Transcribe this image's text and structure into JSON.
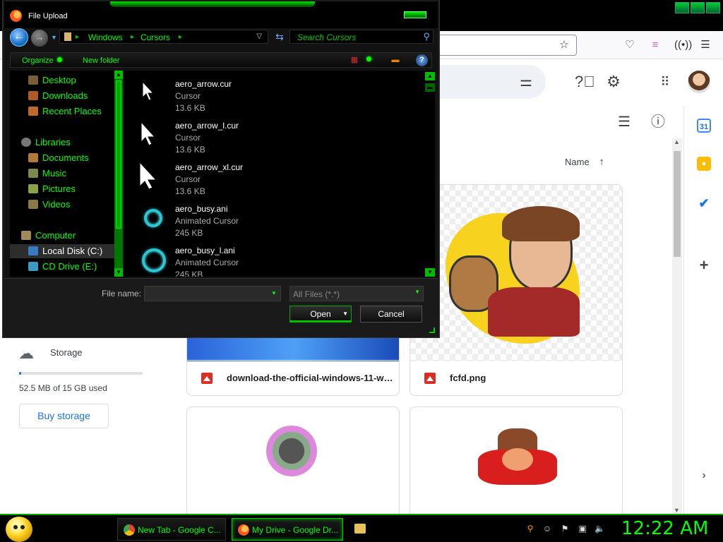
{
  "dialog": {
    "title": "File Upload",
    "breadcrumb": [
      "Windows",
      "Cursors"
    ],
    "search_placeholder": "Search Cursors",
    "toolbar": {
      "organize": "Organize",
      "new_folder": "New folder"
    },
    "nav_items": [
      {
        "label": "Desktop",
        "color": "#7a5c3a"
      },
      {
        "label": "Downloads",
        "color": "#b05a2a"
      },
      {
        "label": "Recent Places",
        "color": "#c06a2a"
      },
      {
        "label": "Libraries",
        "color": "#777777"
      },
      {
        "label": "Documents",
        "color": "#b07a3a"
      },
      {
        "label": "Music",
        "color": "#7a8a4a"
      },
      {
        "label": "Pictures",
        "color": "#8aa04a"
      },
      {
        "label": "Videos",
        "color": "#8a7a4a"
      },
      {
        "label": "Computer",
        "color": "#a08a5a"
      },
      {
        "label": "Local Disk (C:)",
        "color": "#3a7ac0",
        "selected": true
      },
      {
        "label": "CD Drive (E:)",
        "color": "#3a9ac0"
      }
    ],
    "files": [
      {
        "name": "aero_arrow.cur",
        "type": "Cursor",
        "size": "13.6 KB",
        "icon": "arrow-cursor-icon"
      },
      {
        "name": "aero_arrow_l.cur",
        "type": "Cursor",
        "size": "13.6 KB",
        "icon": "arrow-cursor-icon"
      },
      {
        "name": "aero_arrow_xl.cur",
        "type": "Cursor",
        "size": "13.6 KB",
        "icon": "arrow-cursor-icon"
      },
      {
        "name": "aero_busy.ani",
        "type": "Animated Cursor",
        "size": "245 KB",
        "icon": "busy-ring-icon"
      },
      {
        "name": "aero_busy_l.ani",
        "type": "Animated Cursor",
        "size": "245 KB",
        "icon": "busy-ring-icon"
      }
    ],
    "file_name_label": "File name:",
    "file_name_value": "",
    "filter_value": "All Files (*.*)",
    "open_label": "Open",
    "cancel_label": "Cancel"
  },
  "drive": {
    "sort_label": "Name",
    "storage_label": "Storage",
    "storage_used": "52.5 MB of 15 GB used",
    "storage_fraction": 0.0035,
    "buy_storage": "Buy storage",
    "cards": [
      {
        "name": "download-the-official-windows-11-wal..."
      },
      {
        "name": "fcfd.png"
      }
    ],
    "rail_calendar_label": "31"
  },
  "taskbar": {
    "tasks": [
      {
        "label": "New Tab - Google C...",
        "icon": "chrome-icon"
      },
      {
        "label": "My Drive - Google Dr...",
        "icon": "firefox-icon",
        "active": true
      }
    ],
    "clock": "12:22 AM"
  },
  "colors": {
    "accent_green": "#00ff00",
    "drive_blue": "#1a73e8"
  }
}
